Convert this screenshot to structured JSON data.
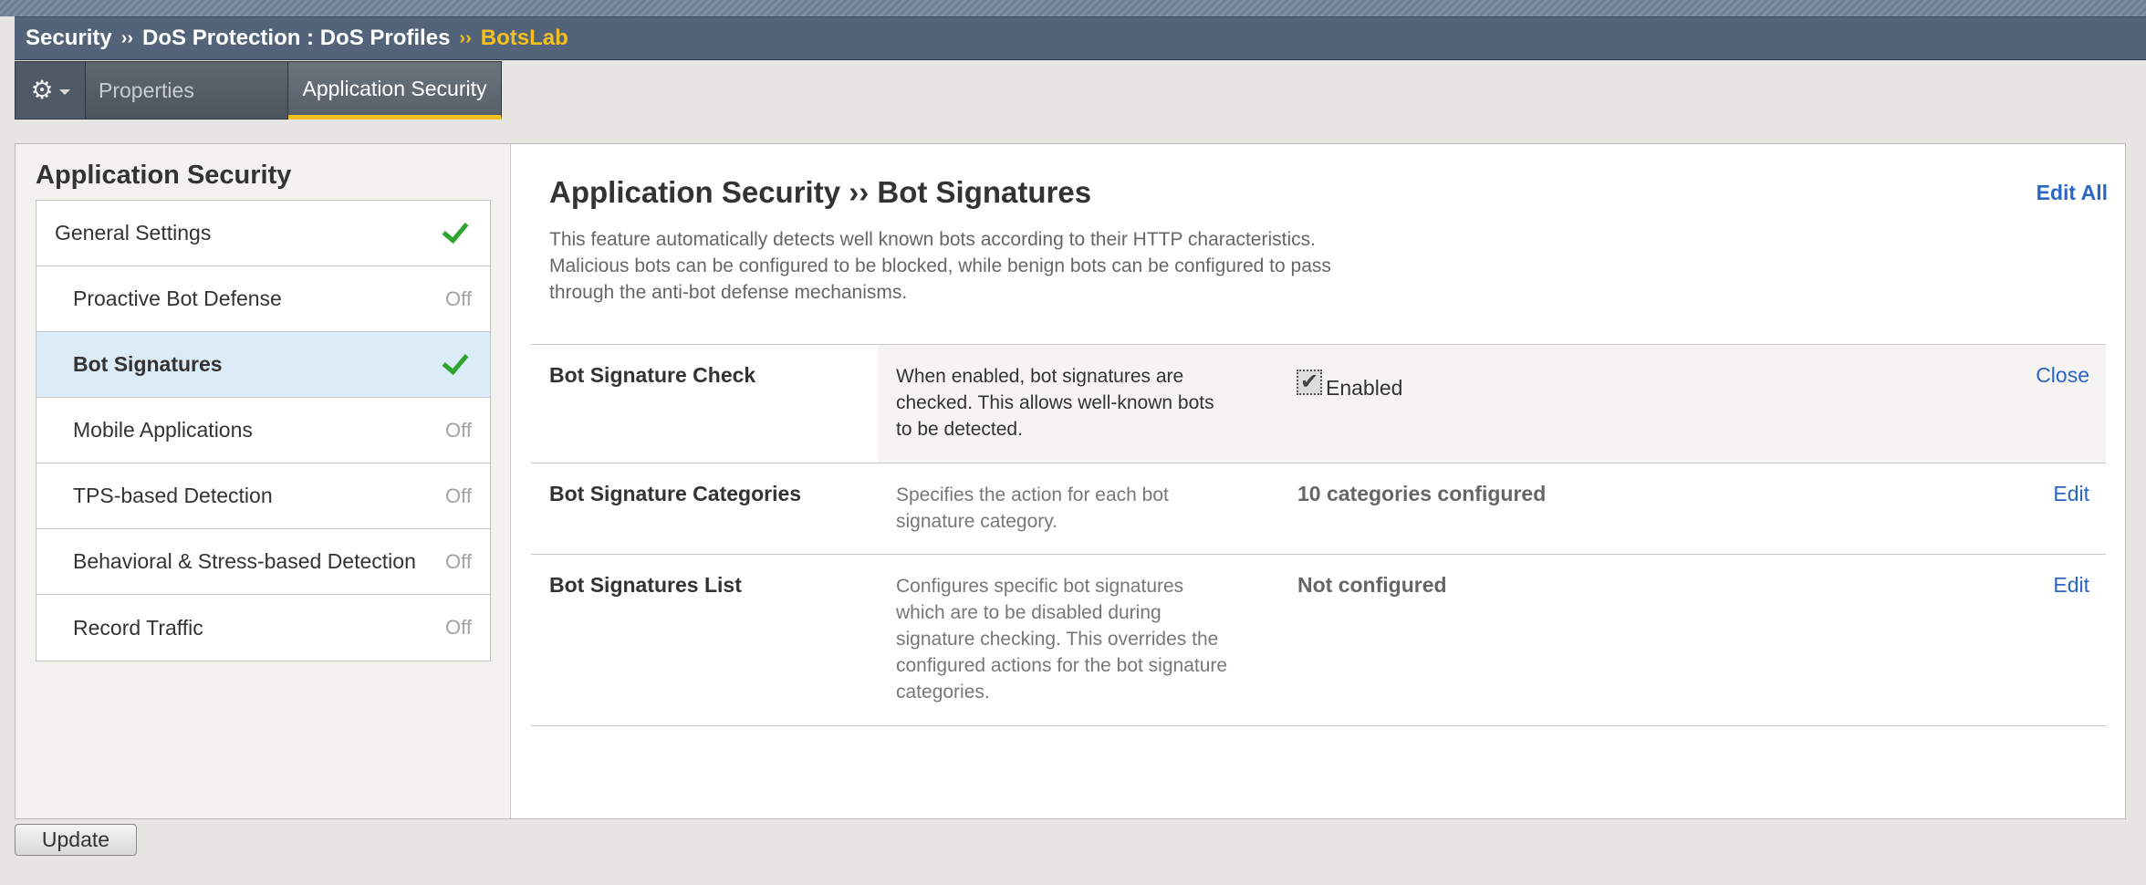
{
  "breadcrumb": {
    "items": [
      "Security",
      "DoS Protection : DoS Profiles"
    ],
    "current": "BotsLab",
    "separator": "››"
  },
  "tabs": {
    "gear_icon": "gear-icon",
    "items": [
      {
        "label": "Properties",
        "active": false
      },
      {
        "label": "Application Security",
        "active": true
      }
    ]
  },
  "sidebar": {
    "title": "Application Security",
    "items": [
      {
        "label": "General Settings",
        "state": "check"
      },
      {
        "label": "Proactive Bot Defense",
        "state": "Off"
      },
      {
        "label": "Bot Signatures",
        "state": "check",
        "active": true
      },
      {
        "label": "Mobile Applications",
        "state": "Off"
      },
      {
        "label": "TPS-based Detection",
        "state": "Off"
      },
      {
        "label": "Behavioral & Stress-based Detection",
        "state": "Off"
      },
      {
        "label": "Record Traffic",
        "state": "Off"
      }
    ]
  },
  "main": {
    "title": "Application Security ›› Bot Signatures",
    "edit_all": "Edit All",
    "description_lines": [
      "This feature automatically detects well known bots according to their HTTP characteristics.",
      "Malicious bots can be configured to be blocked, while benign bots can be configured to pass",
      "through the anti-bot defense mechanisms."
    ],
    "rows": [
      {
        "label": "Bot Signature Check",
        "help_lines": [
          "When enabled, bot signatures are",
          "checked. This allows well-known bots",
          "to be detected."
        ],
        "checkbox_label": "Enabled",
        "checked": true,
        "action": "Close"
      },
      {
        "label": "Bot Signature Categories",
        "help_lines": [
          "Specifies the action for each bot",
          "signature category."
        ],
        "value": "10 categories configured",
        "action": "Edit"
      },
      {
        "label": "Bot Signatures List",
        "help_lines": [
          "Configures specific bot signatures",
          "which are to be disabled during",
          "signature checking. This overrides the",
          "configured actions for the bot signature",
          "categories."
        ],
        "value": "Not configured",
        "action": "Edit"
      }
    ]
  },
  "footer": {
    "update_label": "Update"
  },
  "colors": {
    "accent": "#f4c01e",
    "link": "#2a66c4",
    "check": "#2fa52f",
    "active_row": "#dcebf8"
  }
}
